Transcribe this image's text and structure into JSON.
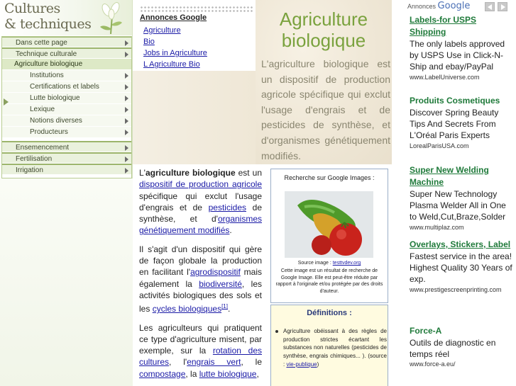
{
  "logo": {
    "line1": "Cultures",
    "line2": "& techniques"
  },
  "menu": [
    {
      "label": "Dans cette page",
      "level": "top",
      "arrow": true
    },
    {
      "label": "Technique culturale",
      "level": "top",
      "arrow": true
    },
    {
      "label": "Agriculture biologique",
      "level": "active",
      "arrow": false
    },
    {
      "label": "Institutions",
      "level": "sub",
      "arrow": true
    },
    {
      "label": "Certifications et labels",
      "level": "sub",
      "arrow": true
    },
    {
      "label": "Lutte biologique",
      "level": "sub",
      "arrow": true
    },
    {
      "label": "Lexique",
      "level": "sub",
      "arrow": true
    },
    {
      "label": "Notions diverses",
      "level": "sub",
      "arrow": true
    },
    {
      "label": "Producteurs",
      "level": "sub",
      "arrow": true
    },
    {
      "label": "Ensemencement",
      "level": "top",
      "arrow": true
    },
    {
      "label": "Fertilisation",
      "level": "top",
      "arrow": true
    },
    {
      "label": "Irrigation",
      "level": "top",
      "arrow": true
    }
  ],
  "ads_top": {
    "title": "Annonces Google",
    "links": [
      "Agriculture",
      "Bio",
      "Jobs in Agriculture",
      "L Agriculture Bio"
    ]
  },
  "hero": {
    "title_line1": "Agriculture",
    "title_line2": "biologique",
    "intro": "L'agriculture biologique est un dispositif de production agricole spécifique qui exclut l'usage d'engrais et de pesticides de synthèse, et d'organismes génétiquement modifiés."
  },
  "article": {
    "p1": {
      "t0": "L'",
      "bold": "agriculture biologique",
      "t1": " est un ",
      "link1": "dispositif de production agricole",
      "t2": " spécifique qui exclut l'usage d'engrais et de ",
      "link2": "pesticides",
      "t3": " de synthèse, et d'",
      "link3": "organismes génétiquement modifiés",
      "t4": "."
    },
    "p2": {
      "t0": "Il s'agit d'un dispositif qui gère de façon globale la production en facilitant l'",
      "link1": "agrodispositif",
      "t1": " mais également la ",
      "link2": "biodiversité",
      "t2": ", les activités biologiques des sols et les ",
      "link3": "cycles biologiques",
      "ref": "[1]",
      "t3": "."
    },
    "p3": {
      "t0": "Les agriculteurs qui pratiquent ce type d'agriculture misent, par exemple, sur la ",
      "link1": "rotation des cultures",
      "t1": ", l'",
      "link2": "engrais vert",
      "t2": ", le ",
      "link3": "compostage",
      "t3": ", la ",
      "link4": "lutte biologique",
      "t4": ","
    }
  },
  "image_box": {
    "title": "Recherche sur Google Images :",
    "source_label": "Source image : ",
    "source_link": "testtvdev.org",
    "caption": "Cette image est un résultat de recherche de Google Image. Elle est peut-être réduite par rapport à l'originale et/ou protégée par des droits d'auteur."
  },
  "definitions": {
    "title": "Définitions :",
    "text": "Agriculture obéissant à des règles de production strictes écartant les substances non naturelles (pesticides de synthèse, engrais chimiques... ). (source : ",
    "link": "vie-publique",
    "end": ")"
  },
  "right_ads": {
    "header_label": "Annonces",
    "header_brand": "Google",
    "items": [
      {
        "title": "Labels-for USPS Shipping",
        "desc": "The only labels approved by USPS Use in Click-N-Ship and ebay/PayPal",
        "url": "www.LabelUniverse.com",
        "underline": true
      },
      {
        "title": "Produits Cosmetiques",
        "desc": "Discover Spring Beauty Tips And Secrets From L'Oréal Paris Experts",
        "url": "LorealParisUSA.com",
        "underline": false
      },
      {
        "title": "Super New Welding Machine",
        "desc": "Super New Technology Plasma Welder All in One to Weld,Cut,Braze,Solder",
        "url": "www.multiplaz.com",
        "underline": true
      },
      {
        "title": "Overlays, Stickers, Label",
        "desc": "Fastest service in the area! Highest Quality 30 Years of exp.",
        "url": "www.prestigescreenprinting.com",
        "underline": true
      },
      {
        "title": "Force-A",
        "desc": "Outils de diagnostic en temps réel",
        "url": "www.force-a.eu/",
        "underline": false
      }
    ]
  },
  "colors": {
    "accent_green": "#7aa23e",
    "ad_title_green": "#1f7a3a",
    "link_blue": "#1a1aa6",
    "menu_bg": "#eaf1dd"
  }
}
